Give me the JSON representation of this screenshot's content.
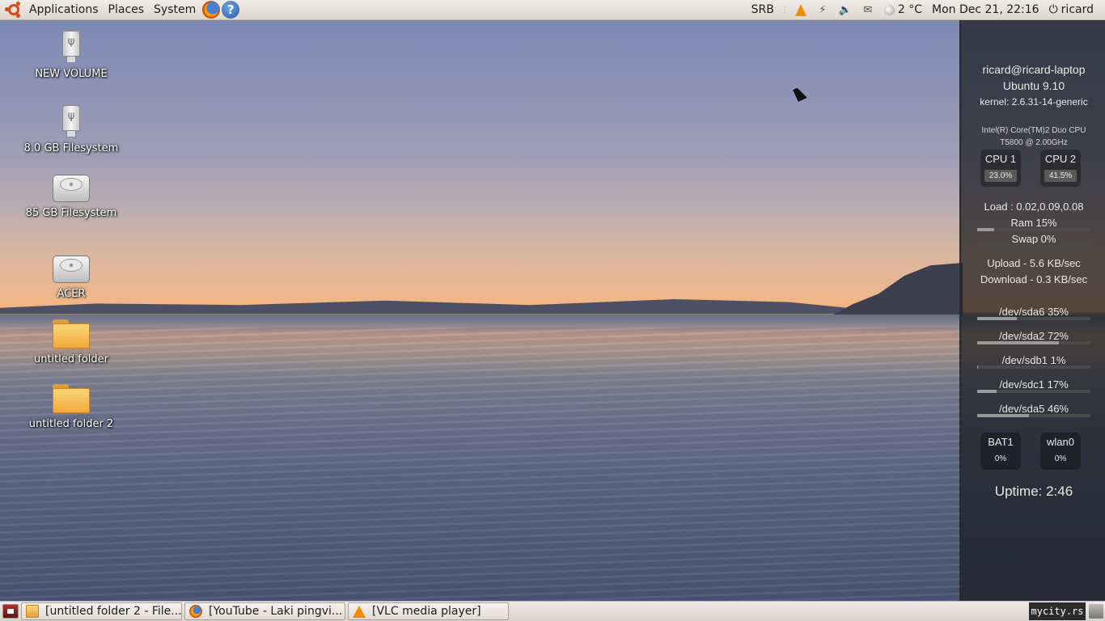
{
  "top_panel": {
    "menus": [
      "Applications",
      "Places",
      "System"
    ],
    "keyboard_layout": "SRB",
    "temperature": "2 °C",
    "datetime": "Mon Dec 21, 22:16",
    "user": "ricard"
  },
  "desktop_icons": [
    {
      "label": "NEW VOLUME",
      "type": "usb"
    },
    {
      "label": "8.0 GB Filesystem",
      "type": "usb"
    },
    {
      "label": "85 GB Filesystem",
      "type": "hdd"
    },
    {
      "label": "ACER",
      "type": "hdd"
    },
    {
      "label": "untitled folder",
      "type": "folder"
    },
    {
      "label": "untitled folder 2",
      "type": "folder"
    }
  ],
  "conky": {
    "user_host": "ricard@ricard-laptop",
    "os": "Ubuntu 9.10",
    "kernel": "kernel: 2.6.31-14-generic",
    "cpu_model_1": "Intel(R) Core(TM)2 Duo CPU",
    "cpu_model_2": "T5800  @ 2.00GHz",
    "cpu1_label": "CPU 1",
    "cpu1_value": "23.0%",
    "cpu2_label": "CPU 2",
    "cpu2_value": "41.5%",
    "load": "Load : 0.02,0.09,0.08",
    "ram": "Ram 15%",
    "ram_pct": 15,
    "swap": "Swap 0%",
    "swap_pct": 0,
    "upload": "Upload - 5.6 KB/sec",
    "download": "Download - 0.3 KB/sec",
    "disks": [
      {
        "label": "/dev/sda6 35%",
        "pct": 35
      },
      {
        "label": "/dev/sda2 72%",
        "pct": 72
      },
      {
        "label": "/dev/sdb1 1%",
        "pct": 1
      },
      {
        "label": "/dev/sdc1 17%",
        "pct": 17
      },
      {
        "label": "/dev/sda5 46%",
        "pct": 46
      }
    ],
    "bat_label": "BAT1",
    "bat_value": "0%",
    "wlan_label": "wlan0",
    "wlan_value": "0%",
    "uptime": "Uptime: 2:46"
  },
  "taskbar": {
    "tasks": [
      "[untitled folder 2 - File...",
      "[YouTube - Laki pingvi...",
      "[VLC media player]"
    ],
    "watermark": "mycity.rs"
  },
  "colors": {
    "ubuntu_orange": "#dd4814",
    "panel_bg": "#e6e1da",
    "conky_bg": "#191b1e"
  }
}
